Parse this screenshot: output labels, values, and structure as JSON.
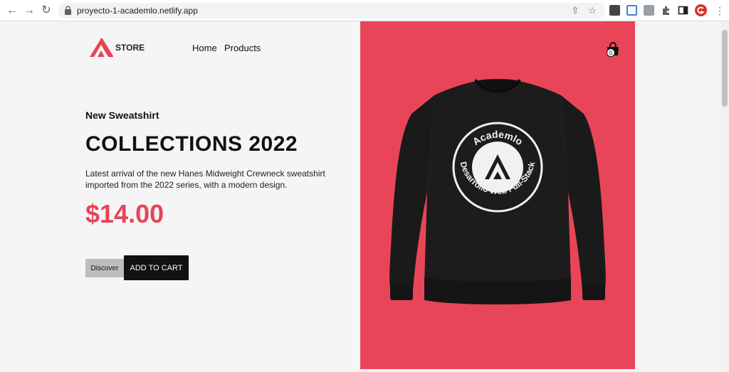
{
  "browser": {
    "url": "proyecto-1-academlo.netlify.app",
    "back_icon": "arrow-left-icon",
    "forward_icon": "arrow-right-icon",
    "reload_icon": "reload-icon"
  },
  "header": {
    "logo_text": "STORE",
    "nav": [
      {
        "label": "Home"
      },
      {
        "label": "Products"
      }
    ],
    "cart_count": "0"
  },
  "main": {
    "subtitle": "New Sweatshirt",
    "headline": "COLLECTIONS 2022",
    "description": "Latest arrival of the new Hanes Midweight Crewneck sweatshirt imported from the 2022 series, with a modern design.",
    "price": "$14.00",
    "discover_label": "Discover",
    "add_to_cart_label": "ADD TO CART"
  },
  "product_image": {
    "print_top": "Academlo",
    "print_bottom": "Desarrollo Web Full-Stack"
  },
  "colors": {
    "accent": "#e84457",
    "hero_bg": "#e84658",
    "dark": "#111111"
  }
}
